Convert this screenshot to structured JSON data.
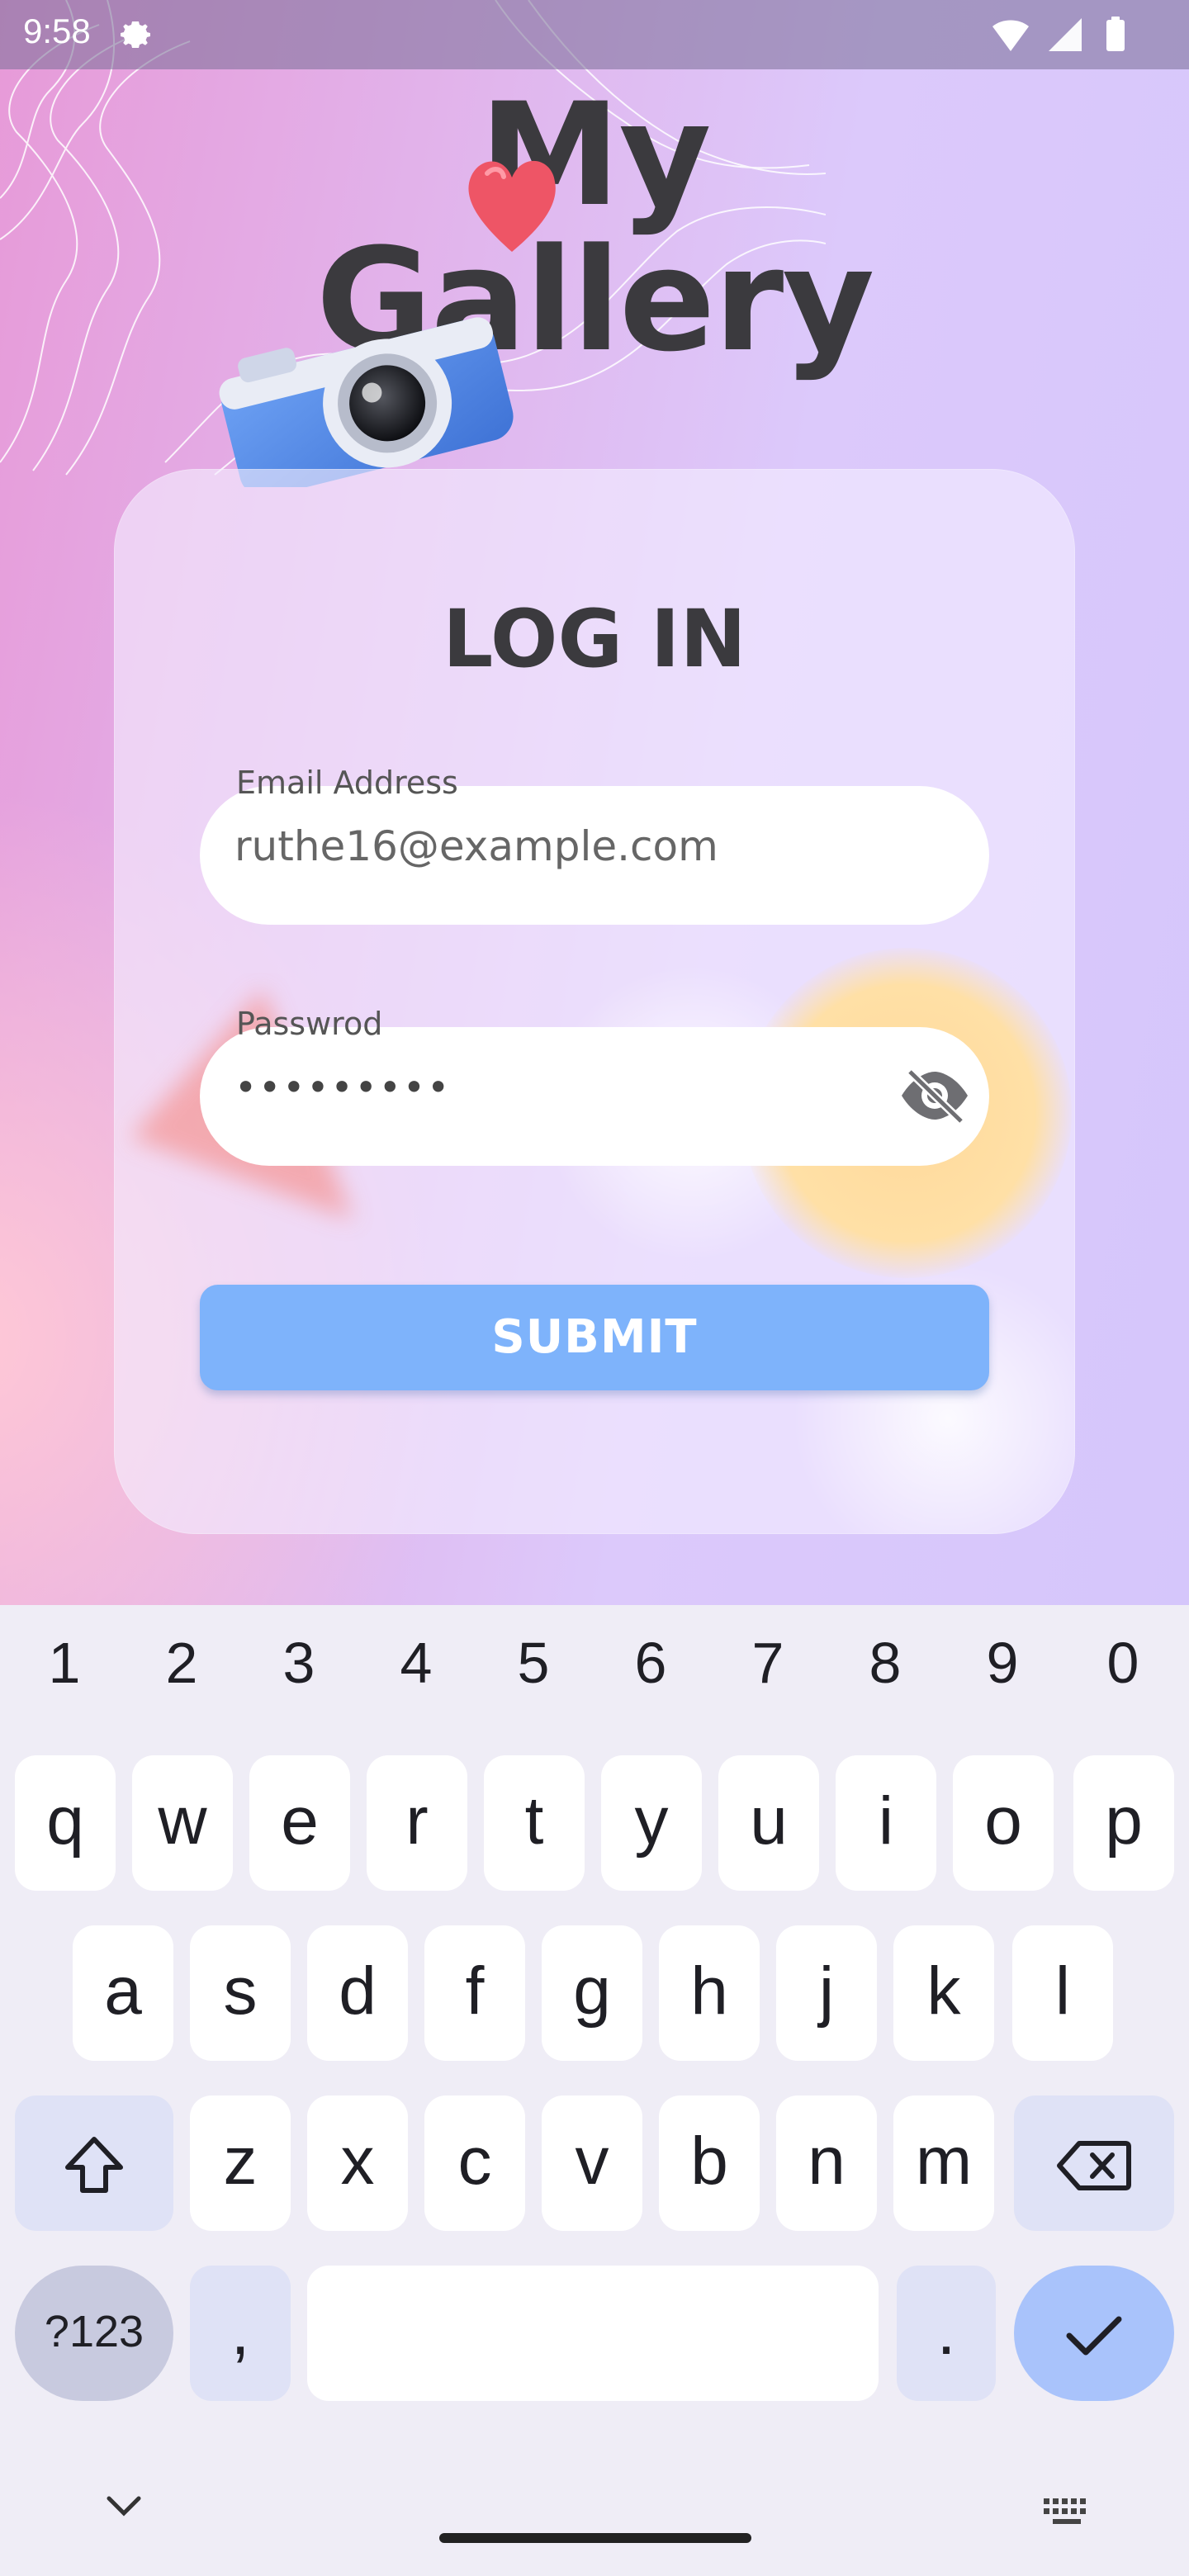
{
  "status_bar": {
    "time": "9:58"
  },
  "app": {
    "title_line1": "My",
    "title_line2": "Gallery"
  },
  "login": {
    "heading": "LOG IN",
    "email_label": "Email Address",
    "email_value": "ruthe16@example.com",
    "password_label": "Passwrod",
    "password_value": "•••••••••",
    "submit_label": "SUBMIT"
  },
  "keyboard": {
    "number_row": [
      "1",
      "2",
      "3",
      "4",
      "5",
      "6",
      "7",
      "8",
      "9",
      "0"
    ],
    "row1": [
      "q",
      "w",
      "e",
      "r",
      "t",
      "y",
      "u",
      "i",
      "o",
      "p"
    ],
    "row2": [
      "a",
      "s",
      "d",
      "f",
      "g",
      "h",
      "j",
      "k",
      "l"
    ],
    "row3": [
      "z",
      "x",
      "c",
      "v",
      "b",
      "n",
      "m"
    ],
    "symbols_label": "?123",
    "comma_label": ",",
    "period_label": "."
  },
  "colors": {
    "submit_bg": "#7eb3fb",
    "title_text": "#3b3a3e",
    "done_key": "#a9c3fb"
  },
  "icons": [
    "settings-gear-icon",
    "wifi-icon",
    "signal-icon",
    "battery-icon",
    "heart-icon",
    "camera-icon",
    "eye-off-icon",
    "shift-icon",
    "backspace-icon",
    "checkmark-icon",
    "chevron-down-icon",
    "keyboard-icon"
  ]
}
